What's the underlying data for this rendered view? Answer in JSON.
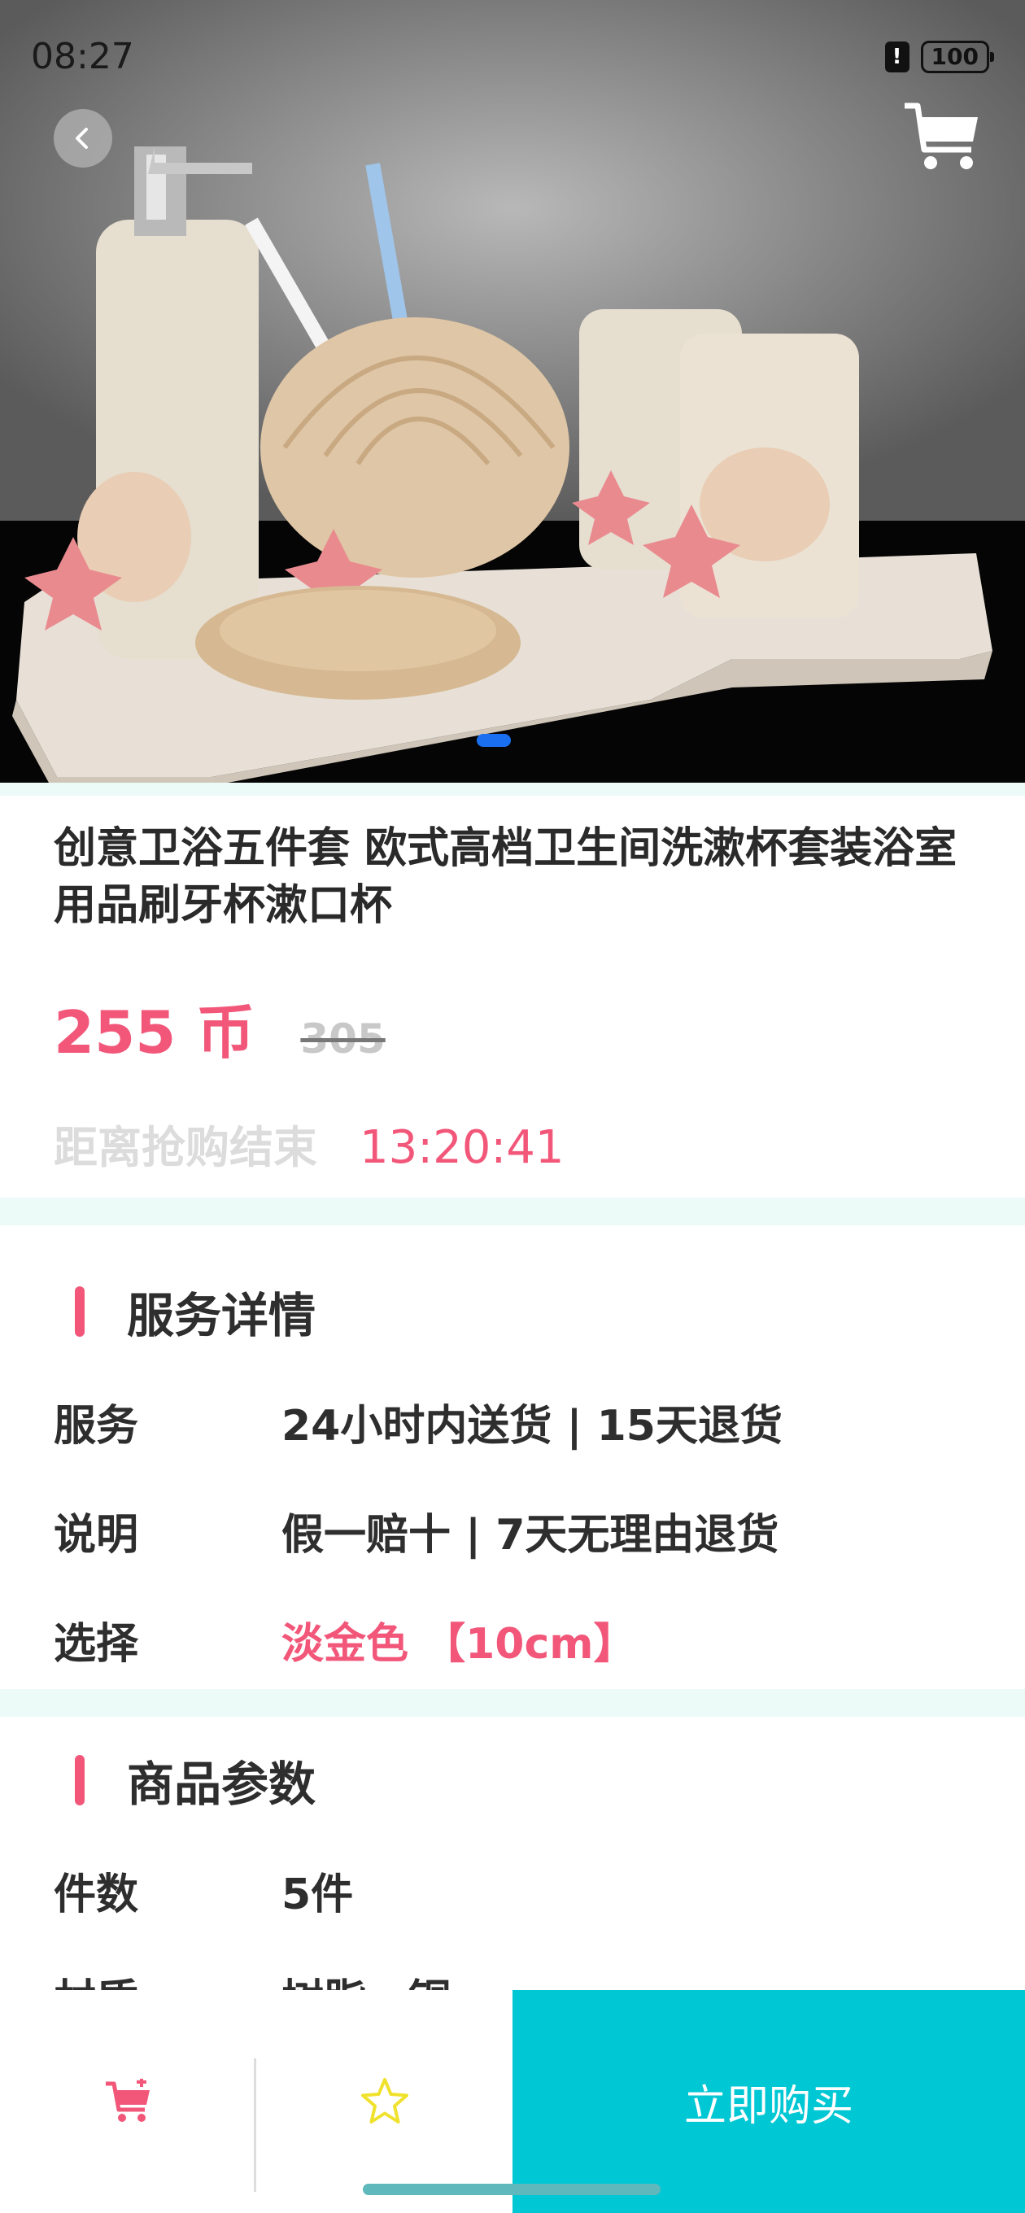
{
  "status_bar": {
    "time": "08:27",
    "battery": "100"
  },
  "icons": {
    "back": "chevron-left-icon",
    "cart": "shopping-cart-icon",
    "favorite": "star-outline-icon",
    "alert": "alert-icon",
    "battery": "battery-icon"
  },
  "product": {
    "title": "创意卫浴五件套 欧式高档卫生间洗漱杯套装浴室用品刷牙杯漱口杯",
    "price": "255 币",
    "original_price": "305",
    "countdown_label": "距离抢购结束",
    "countdown_time": "13:20:41"
  },
  "service_section": {
    "title": "服务详情",
    "rows": [
      {
        "key": "服务",
        "value": "24小时内送货 | 15天退货"
      },
      {
        "key": "说明",
        "value": "假一赔十 | 7天无理由退货"
      },
      {
        "key": "选择",
        "value": "淡金色 【10cm】"
      }
    ]
  },
  "params_section": {
    "title": "商品参数",
    "rows": [
      {
        "key": "件数",
        "value": "5件"
      },
      {
        "key": "材质",
        "value": "树脂、铜"
      }
    ]
  },
  "bottom_bar": {
    "buy_label": "立即购买"
  },
  "colors": {
    "accent": "#f2577a",
    "buy": "#00c7d4",
    "band": "#ecfbf8",
    "star": "#f0e22c"
  }
}
